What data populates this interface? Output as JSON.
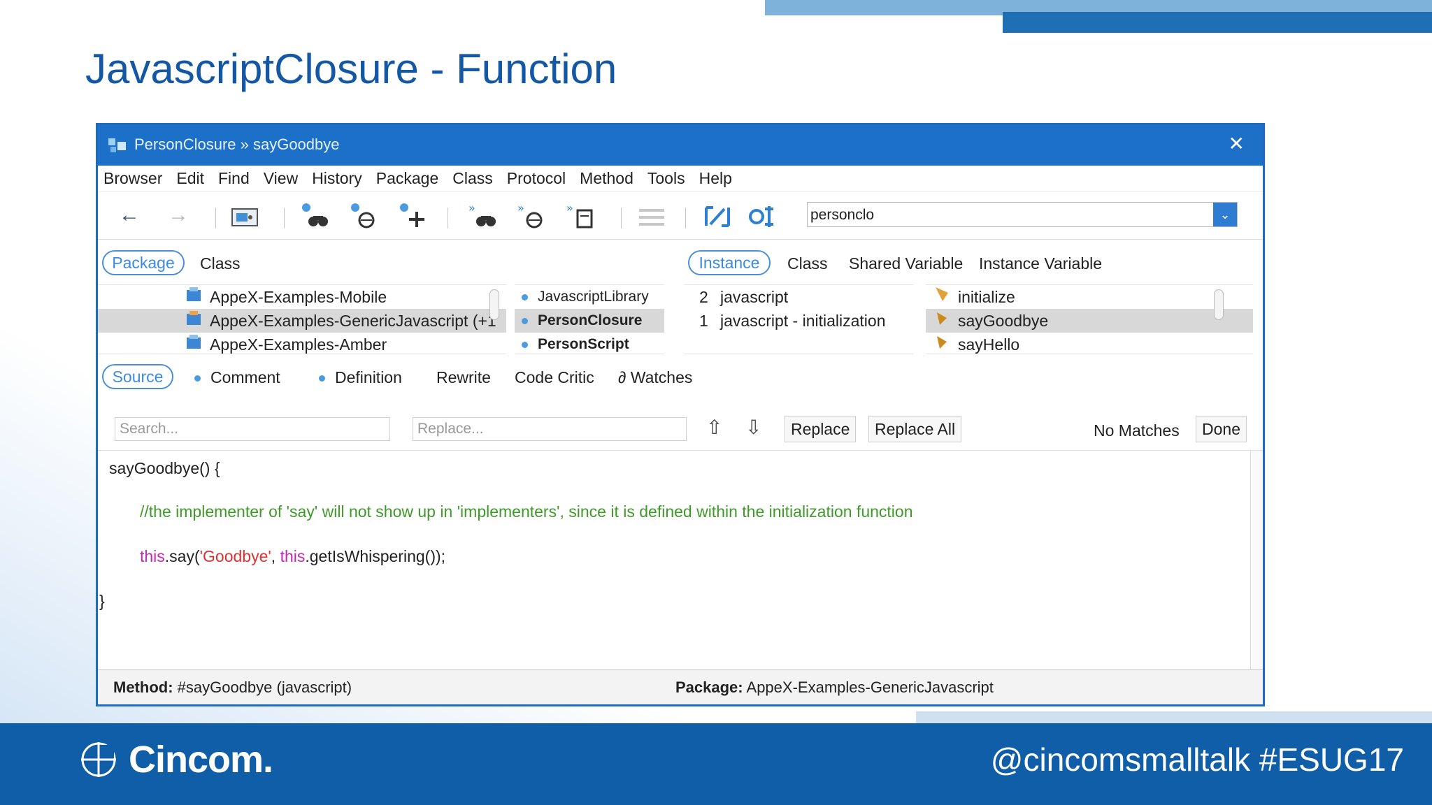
{
  "slide": {
    "title": "JavascriptClosure - Function",
    "footer_handle": "@cincomsmalltalk #ESUG17",
    "logo_text": "Cincom."
  },
  "window": {
    "title": "PersonClosure » sayGoodbye",
    "close": "✕",
    "menu": [
      "Browser",
      "Edit",
      "Find",
      "View",
      "History",
      "Package",
      "Class",
      "Protocol",
      "Method",
      "Tools",
      "Help"
    ],
    "search_combo_value": "personclo",
    "combo_dropdown_icon": "⌄"
  },
  "toolbar": {
    "back": "←",
    "forward": "→",
    "icons": [
      "back-arrow-icon",
      "forward-arrow-icon",
      "browse-window-icon",
      "find-references-icon",
      "find-messages-icon",
      "add-icon",
      "senders-binoculars-icon",
      "implementors-icon",
      "class-references-icon",
      "list-icon",
      "diff-icon",
      "compare-icon"
    ]
  },
  "navigator_tabs": {
    "package": "Package",
    "class": "Class",
    "instance": "Instance",
    "class2": "Class",
    "shared_variable": "Shared Variable",
    "instance_variable": "Instance Variable"
  },
  "packages": [
    {
      "name": "AppeX-Examples-Mobile",
      "selected": false
    },
    {
      "name": "AppeX-Examples-GenericJavascript (+1",
      "selected": true
    },
    {
      "name": "AppeX-Examples-Amber",
      "selected": false
    }
  ],
  "classes": [
    {
      "name": "JavascriptLibrary",
      "selected": false
    },
    {
      "name": "PersonClosure",
      "selected": true
    },
    {
      "name": "PersonScript",
      "selected": false
    }
  ],
  "protocols": [
    {
      "count": "2",
      "name": "javascript"
    },
    {
      "count": "1",
      "name": "javascript - initialization"
    }
  ],
  "methods": [
    {
      "name": "initialize",
      "selected": false
    },
    {
      "name": "sayGoodbye",
      "selected": true
    },
    {
      "name": "sayHello",
      "selected": false
    }
  ],
  "editor_tabs": {
    "source": "Source",
    "comment": "Comment",
    "definition": "Definition",
    "rewrite": "Rewrite",
    "code_critic": "Code Critic",
    "watches": "∂ Watches"
  },
  "find_bar": {
    "search_placeholder": "Search...",
    "replace_placeholder": "Replace...",
    "up": "⇧",
    "down": "⇩",
    "replace": "Replace",
    "replace_all": "Replace All",
    "status": "No Matches",
    "done": "Done"
  },
  "code": {
    "line1": "sayGoodbye() {",
    "comment": "//the implementer of 'say' will not show up in 'implementers', since it is defined within the initialization function",
    "kw1": "this",
    "part1": ".say(",
    "str1": "'Goodbye'",
    "part2": ", ",
    "kw2": "this",
    "part3": ".getIsWhispering());",
    "closing": "}"
  },
  "status": {
    "method_label": "Method:",
    "method_value": " #sayGoodbye (javascript)",
    "package_label": "Package:",
    "package_value": " AppeX-Examples-GenericJavascript"
  },
  "colors": {
    "title_blue": "#1458a5",
    "titlebar": "#1d70c8",
    "footer": "#0f5ea7",
    "comment_green": "#3f9a2a",
    "keyword_magenta": "#c02ab5",
    "string_red": "#d93232"
  }
}
